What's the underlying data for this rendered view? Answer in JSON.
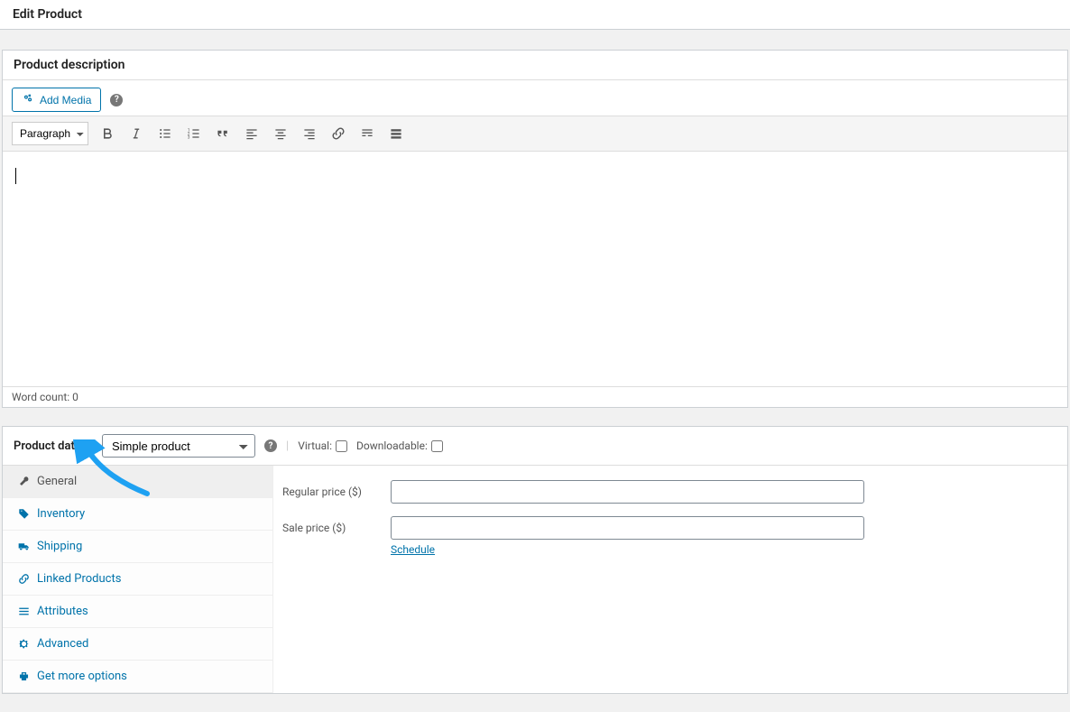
{
  "page_title": "Edit Product",
  "description_panel": {
    "title": "Product description",
    "add_media": "Add Media",
    "paragraph_select": "Paragraph",
    "word_count": "Word count: 0"
  },
  "product_data": {
    "label": "Product data —",
    "type_selected": "Simple product",
    "virtual_label": "Virtual:",
    "downloadable_label": "Downloadable:",
    "tabs": [
      {
        "key": "general",
        "label": "General",
        "icon": "wrench",
        "active": true
      },
      {
        "key": "inventory",
        "label": "Inventory",
        "icon": "tag",
        "active": false
      },
      {
        "key": "shipping",
        "label": "Shipping",
        "icon": "truck",
        "active": false
      },
      {
        "key": "linked",
        "label": "Linked Products",
        "icon": "link",
        "active": false
      },
      {
        "key": "attributes",
        "label": "Attributes",
        "icon": "list",
        "active": false
      },
      {
        "key": "advanced",
        "label": "Advanced",
        "icon": "gear",
        "active": false
      },
      {
        "key": "more",
        "label": "Get more options",
        "icon": "plugin",
        "active": false
      }
    ],
    "fields": {
      "regular_price_label": "Regular price ($)",
      "sale_price_label": "Sale price ($)",
      "schedule_link": "Schedule"
    }
  }
}
